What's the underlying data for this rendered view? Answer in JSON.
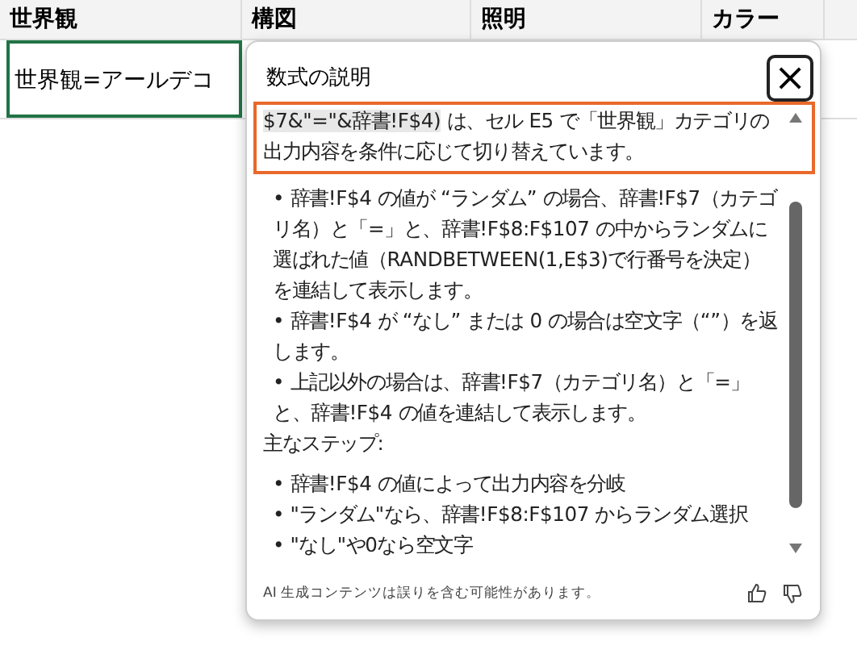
{
  "sheet": {
    "columns": [
      "世界観",
      "構図",
      "照明",
      "カラー"
    ],
    "cell": {
      "value": "世界観=アールデコ",
      "selected": true
    }
  },
  "panel": {
    "title": "数式の説明",
    "close": "×",
    "intro": {
      "code": "$7&\"=\"&辞書!F$4)",
      "text": " は、セル E5 で「世界観」カテゴリの出力内容を条件に応じて切り替えています。",
      "highlighted": true
    },
    "details": [
      "• 辞書!F$4 の値が “ランダム” の場合、辞書!F$7（カテゴリ名）と「=」と、辞書!F$8:F$107 の中からランダムに選ばれた値（RANDBETWEEN(1,E$3)で行番号を決定）を連結して表示します。",
      "• 辞書!F$4 が “なし” または 0 の場合は空文字（“”）を返します。",
      "• 上記以外の場合は、辞書!F$7（カテゴリ名）と「=」と、辞書!F$4 の値を連結して表示します。"
    ],
    "steps_title": "主なステップ:",
    "steps": [
      "• 辞書!F$4 の値によって出力内容を分岐",
      "• \"ランダム\"なら、辞書!F$8:F$107 からランダム選択",
      "• \"なし\"や0なら空文字"
    ],
    "footer": "AI 生成コンテンツは誤りを含む可能性があります。"
  }
}
